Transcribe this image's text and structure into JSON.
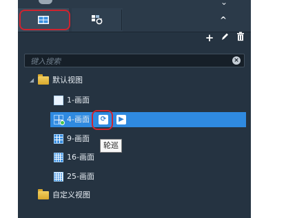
{
  "search": {
    "placeholder": "键入搜索"
  },
  "tree": {
    "root_folder": "默认视图",
    "layouts": [
      "1-画面",
      "4-画面",
      "9-画面",
      "16-画面",
      "25-画面"
    ],
    "custom_folder": "自定义视图"
  },
  "tooltip": "轮巡",
  "colors": {
    "panel_bg": "#253341",
    "selection": "#2f8ae0",
    "highlight": "#d0232e"
  },
  "icons": [
    "grid-layout-icon",
    "carousel-icon",
    "chevron-up-icon",
    "add-icon",
    "edit-icon",
    "delete-icon",
    "folder-icon",
    "refresh-icon",
    "play-icon"
  ]
}
